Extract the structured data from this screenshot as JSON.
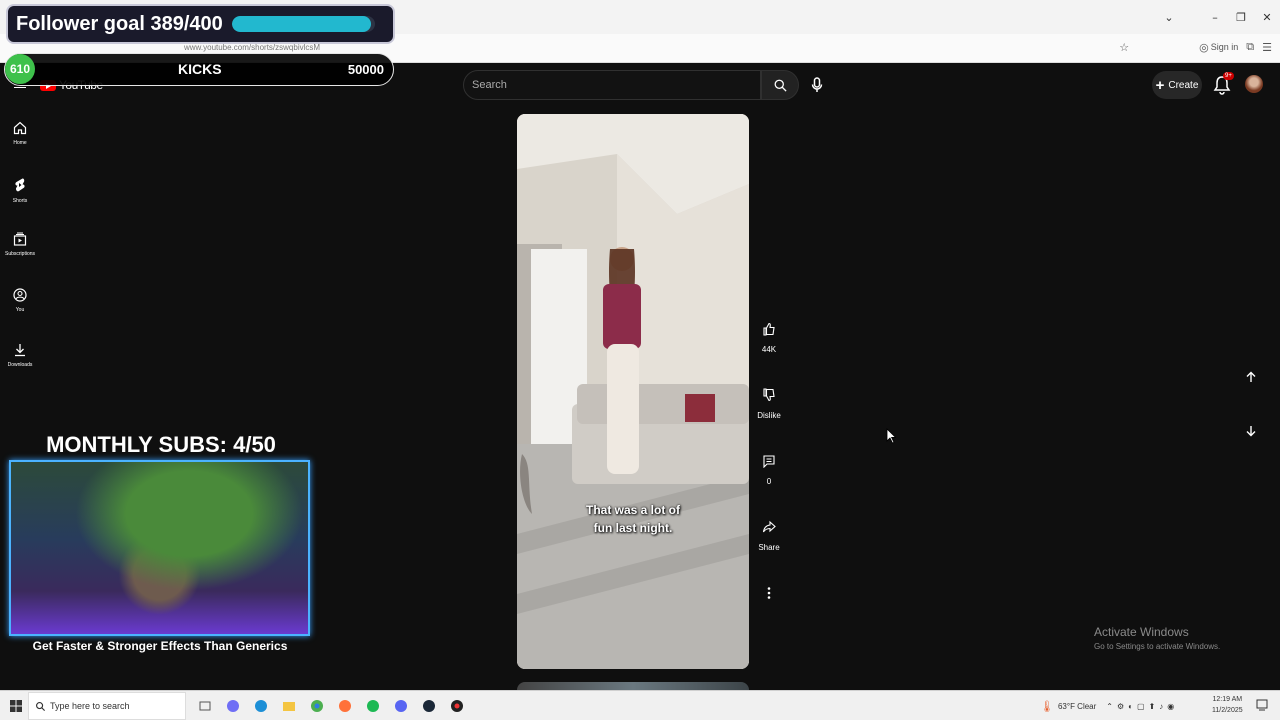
{
  "browser": {
    "url": "www.youtube.com/shorts/zswqbivlcsM",
    "sign_in": "Sign in"
  },
  "youtube": {
    "logo": "YouTube",
    "search_placeholder": "Search",
    "create_label": "Create",
    "notifications_badge": "9+",
    "sidebar": [
      {
        "label": "Home",
        "icon": "home-icon"
      },
      {
        "label": "Shorts",
        "icon": "shorts-icon"
      },
      {
        "label": "Subscriptions",
        "icon": "subscriptions-icon"
      },
      {
        "label": "You",
        "icon": "you-icon"
      },
      {
        "label": "Downloads",
        "icon": "download-icon"
      }
    ],
    "video": {
      "caption_line1": "That was a lot of",
      "caption_line2": "fun last night."
    },
    "actions": {
      "like_count": "44K",
      "dislike_label": "Dislike",
      "comments_count": "0",
      "share_label": "Share"
    }
  },
  "overlays": {
    "follower_goal_text": "Follower goal 389/400",
    "follower_progress": 0.9725,
    "kicks_count": "610",
    "kicks_label": "KICKS",
    "kicks_target": "50000",
    "monthly_subs": "MONTHLY SUBS: 4/50",
    "promo": "Get Faster & Stronger Effects Than Generics"
  },
  "windows": {
    "activate_title": "Activate Windows",
    "activate_sub": "Go to Settings to activate Windows."
  },
  "taskbar": {
    "search_placeholder": "Type here to search",
    "weather": "63°F  Clear",
    "time": "12:19 AM",
    "date": "11/2/2025"
  },
  "colors": {
    "progress": "#22b8cf",
    "kicks_circle": "#3ec14b",
    "yt_red": "#ff0000"
  }
}
